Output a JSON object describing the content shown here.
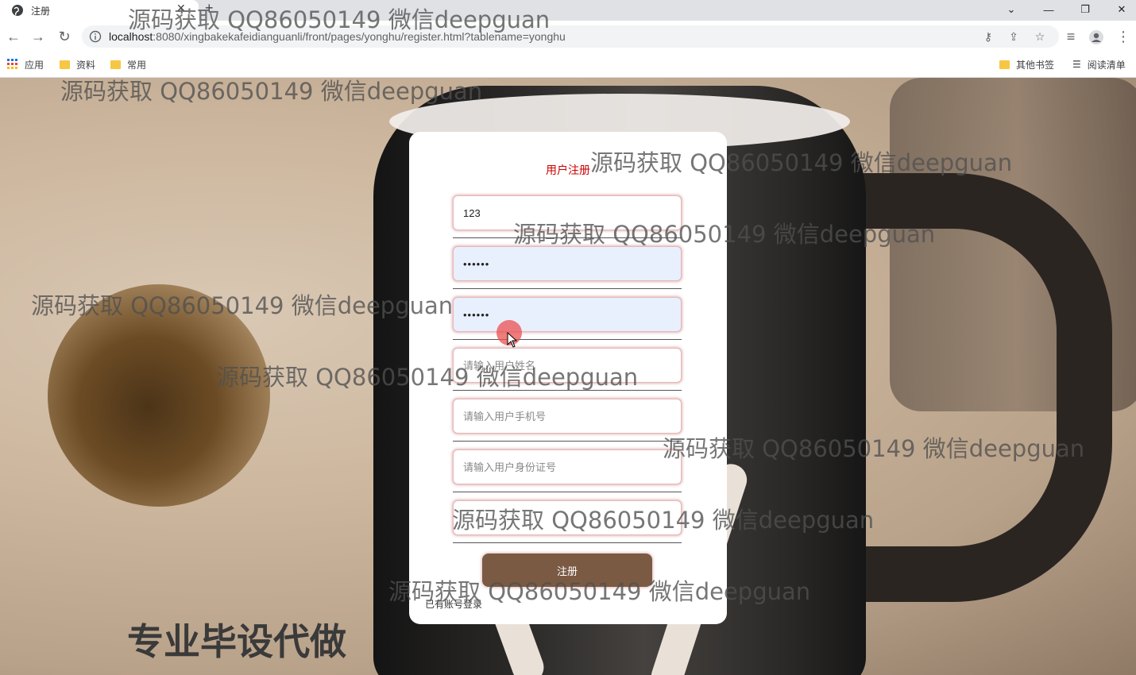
{
  "browser": {
    "tab_title": "注册",
    "url_host": "localhost",
    "url_rest": ":8080/xingbakekafeidianguanli/front/pages/yonghu/register.html?tablename=yonghu",
    "bookmarks": [
      {
        "label": "应用",
        "icon": "apps-grid-icon"
      },
      {
        "label": "资料",
        "icon": "folder-icon"
      },
      {
        "label": "常用",
        "icon": "folder-icon"
      }
    ],
    "other_bookmarks": "其他书签",
    "reading_list": "阅读清单"
  },
  "form": {
    "title": "用户注册",
    "title_color": "#cc0000",
    "fields": [
      {
        "name": "account",
        "value": "123",
        "placeholder": "",
        "type": "text"
      },
      {
        "name": "password",
        "value": "••••••",
        "placeholder": "",
        "type": "password"
      },
      {
        "name": "confirm-password",
        "value": "••••••",
        "placeholder": "",
        "type": "password"
      },
      {
        "name": "name",
        "value": "",
        "placeholder": "请输入用户姓名",
        "type": "text"
      },
      {
        "name": "phone",
        "value": "",
        "placeholder": "请输入用户手机号",
        "type": "text"
      },
      {
        "name": "id-number",
        "value": "",
        "placeholder": "请输入用户身份证号",
        "type": "text"
      },
      {
        "name": "extra",
        "value": "",
        "placeholder": "",
        "type": "text"
      }
    ],
    "submit_label": "注册",
    "submit_color": "#7b5a44",
    "login_link": "已有账号登录"
  },
  "watermarks": [
    "源码获取 QQ86050149 微信deepguan",
    "源码获取 QQ86050149 微信deepguan",
    "源码获取 QQ86050149 微信deepguan",
    "源码获取 QQ86050149 微信deepguan",
    "源码获取 QQ86050149 微信deepguan",
    "源码获取 QQ86050149 微信deepguan",
    "源码获取 QQ86050149 微信deepguan",
    "源码获取 QQ86050149 微信deepguan",
    "源码获取 QQ86050149 微信deepguan"
  ],
  "promo": "专业毕设代做"
}
